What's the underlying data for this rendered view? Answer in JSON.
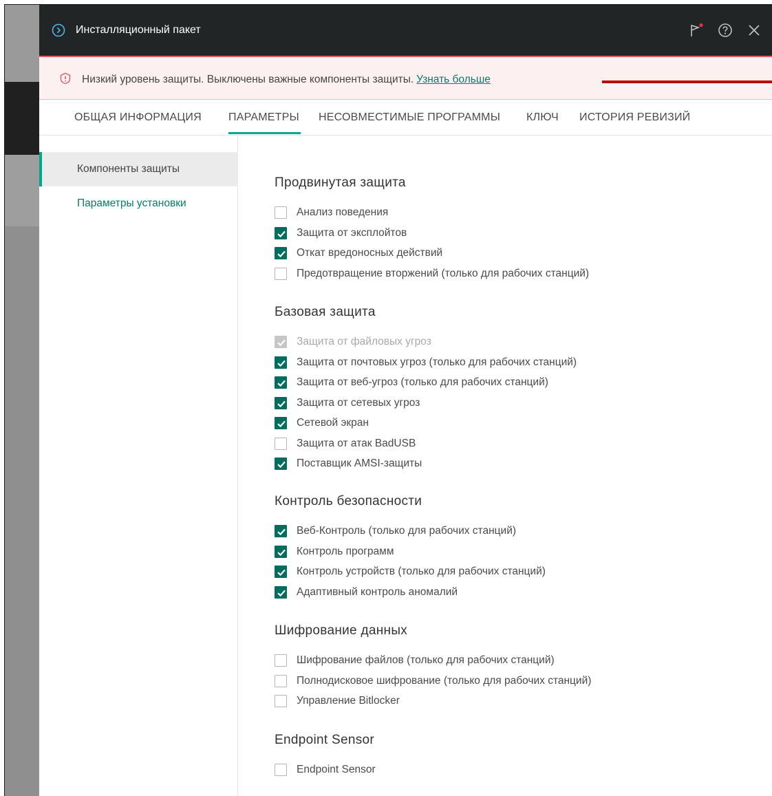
{
  "window": {
    "title": "Инсталляционный пакет"
  },
  "alert": {
    "text": "Низкий уровень защиты. Выключены важные компоненты защиты.",
    "link": "Узнать больше"
  },
  "tabs": [
    {
      "label": "ОБЩАЯ ИНФОРМАЦИЯ",
      "active": false
    },
    {
      "label": "ПАРАМЕТРЫ",
      "active": true
    },
    {
      "label": "НЕСОВМЕСТИМЫЕ ПРОГРАММЫ",
      "active": false
    },
    {
      "label": "КЛЮЧ",
      "active": false
    },
    {
      "label": "ИСТОРИЯ РЕВИЗИЙ",
      "active": false
    }
  ],
  "sidebar": {
    "items": [
      {
        "label": "Компоненты защиты",
        "active": true
      },
      {
        "label": "Параметры установки",
        "active": false
      }
    ]
  },
  "sections": [
    {
      "title": "Продвинутая защита",
      "items": [
        {
          "label": "Анализ поведения",
          "checked": false,
          "disabled": false
        },
        {
          "label": "Защита от эксплойтов",
          "checked": true,
          "disabled": false
        },
        {
          "label": "Откат вредоносных действий",
          "checked": true,
          "disabled": false
        },
        {
          "label": "Предотвращение вторжений (только для рабочих станций)",
          "checked": false,
          "disabled": false
        }
      ]
    },
    {
      "title": "Базовая защита",
      "items": [
        {
          "label": "Защита от файловых угроз",
          "checked": true,
          "disabled": true
        },
        {
          "label": "Защита от почтовых угроз (только для рабочих станций)",
          "checked": true,
          "disabled": false
        },
        {
          "label": "Защита от веб-угроз (только для рабочих станций)",
          "checked": true,
          "disabled": false
        },
        {
          "label": "Защита от сетевых угроз",
          "checked": true,
          "disabled": false
        },
        {
          "label": "Сетевой экран",
          "checked": true,
          "disabled": false
        },
        {
          "label": "Защита от атак BadUSB",
          "checked": false,
          "disabled": false
        },
        {
          "label": "Поставщик AMSI-защиты",
          "checked": true,
          "disabled": false
        }
      ]
    },
    {
      "title": "Контроль безопасности",
      "items": [
        {
          "label": "Веб-Контроль (только для рабочих станций)",
          "checked": true,
          "disabled": false
        },
        {
          "label": "Контроль программ",
          "checked": true,
          "disabled": false
        },
        {
          "label": "Контроль устройств (только для рабочих станций)",
          "checked": true,
          "disabled": false
        },
        {
          "label": "Адаптивный контроль аномалий",
          "checked": true,
          "disabled": false
        }
      ]
    },
    {
      "title": "Шифрование данных",
      "items": [
        {
          "label": "Шифрование файлов (только для рабочих станций)",
          "checked": false,
          "disabled": false
        },
        {
          "label": "Полнодисковое шифрование (только для рабочих станций)",
          "checked": false,
          "disabled": false
        },
        {
          "label": "Управление Bitlocker",
          "checked": false,
          "disabled": false
        }
      ]
    },
    {
      "title": "Endpoint Sensor",
      "items": [
        {
          "label": "Endpoint Sensor",
          "checked": false,
          "disabled": false
        }
      ]
    }
  ],
  "colors": {
    "accent": "#00a88e",
    "checkbox_checked": "#006e5e",
    "link": "#007e69",
    "alert_bg": "#fdf0f1",
    "alert_bar": "#c00000",
    "titlebar": "#222526"
  },
  "icons": {
    "title": "chevron-circle-icon",
    "flag": "flag-notification-icon",
    "help": "help-icon",
    "close": "close-icon",
    "alert": "warning-icon",
    "check": "checkmark-icon"
  }
}
